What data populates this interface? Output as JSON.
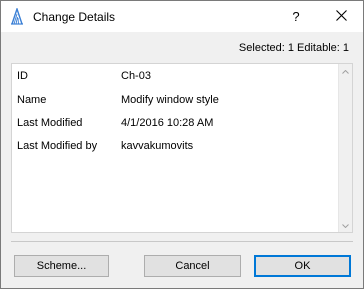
{
  "window": {
    "title": "Change Details",
    "help_label": "?"
  },
  "status": {
    "text": "Selected: 1 Editable: 1"
  },
  "details": [
    {
      "label": "ID",
      "value": "Ch-03"
    },
    {
      "label": "Name",
      "value": "Modify window style"
    },
    {
      "label": "Last Modified",
      "value": "4/1/2016 10:28 AM"
    },
    {
      "label": "Last Modified by",
      "value": "kavvakumovits"
    }
  ],
  "buttons": {
    "scheme_label": "Scheme...",
    "cancel_label": "Cancel",
    "ok_label": "OK"
  },
  "icons": {
    "app": "archicad-icon",
    "close": "close-icon",
    "scroll_up": "chevron-up-icon",
    "scroll_down": "chevron-down-icon"
  },
  "colors": {
    "accent": "#0078d7",
    "app_icon": "#3a7fd5"
  }
}
